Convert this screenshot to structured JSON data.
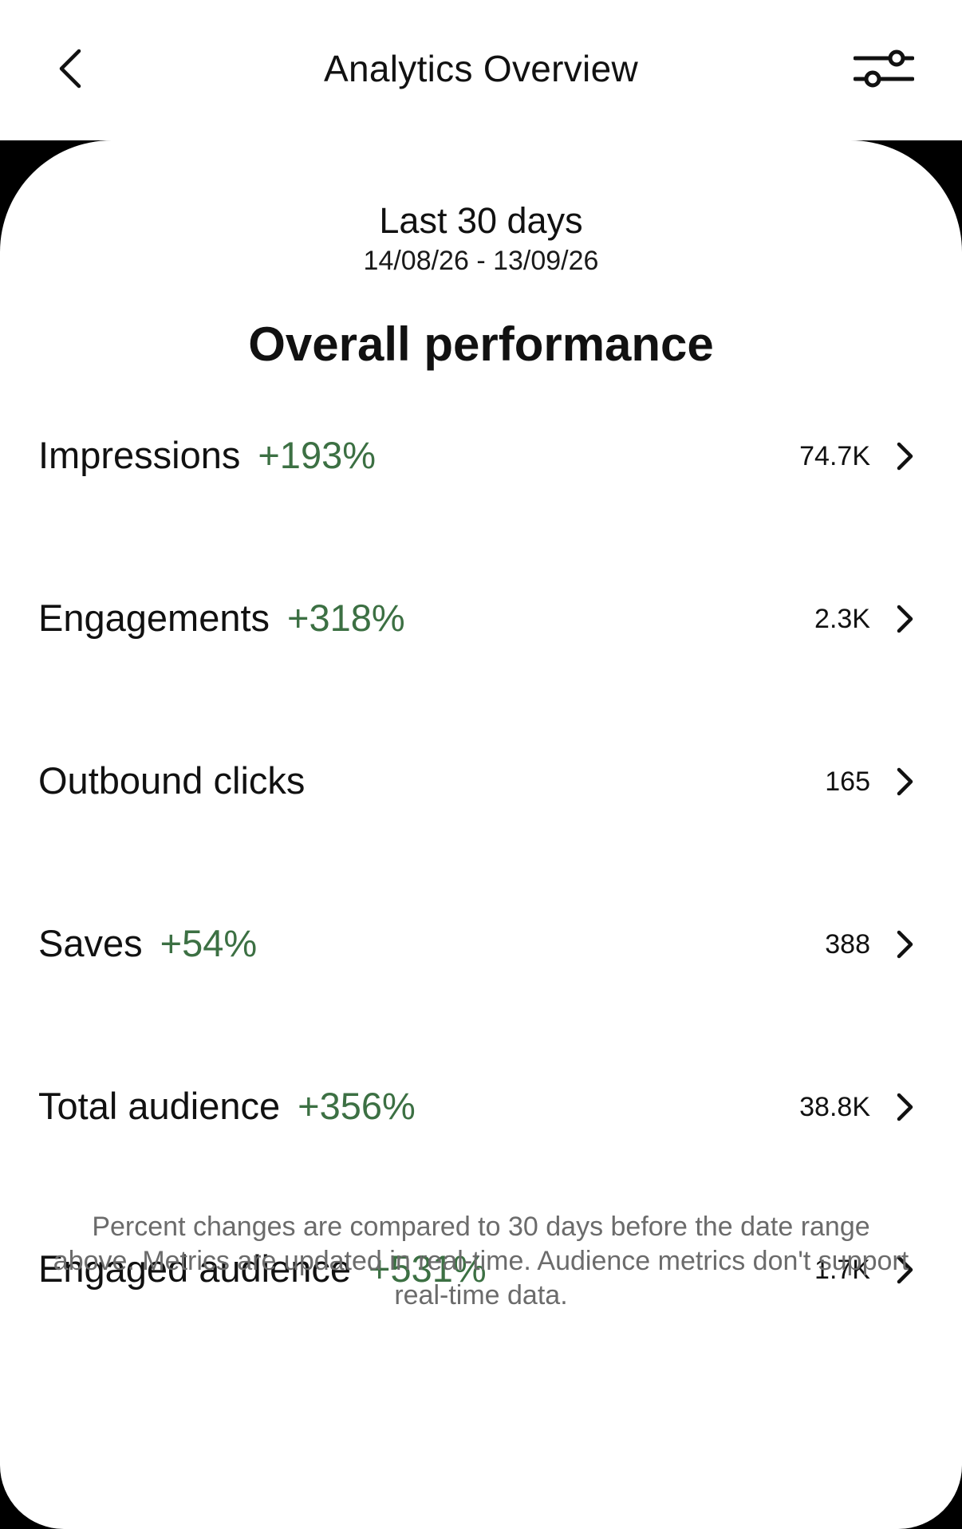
{
  "header": {
    "title": "Analytics Overview",
    "back_icon": "chevron-left-icon",
    "filter_icon": "sliders-icon"
  },
  "date_range": {
    "title": "Last 30 days",
    "dates": "14/08/26 - 13/09/26"
  },
  "section": {
    "title": "Overall performance"
  },
  "metrics": [
    {
      "label": "Impressions",
      "change": "+193%",
      "value": "74.7K"
    },
    {
      "label": "Engagements",
      "change": "+318%",
      "value": "2.3K"
    },
    {
      "label": "Outbound clicks",
      "change": "",
      "value": "165"
    },
    {
      "label": "Saves",
      "change": "+54%",
      "value": "388"
    },
    {
      "label": "Total audience",
      "change": "+356%",
      "value": "38.8K"
    },
    {
      "label": "Engaged audience",
      "change": "+531%",
      "value": "1.7K"
    }
  ],
  "footnote": "Percent changes are compared to 30 days before the date range above. Metrics are updated in real-time. Audience metrics don't support real-time data.",
  "colors": {
    "positive_change": "#3c7043",
    "footnote_text": "#6b6b6b",
    "background_frame": "#000000",
    "surface": "#ffffff"
  }
}
